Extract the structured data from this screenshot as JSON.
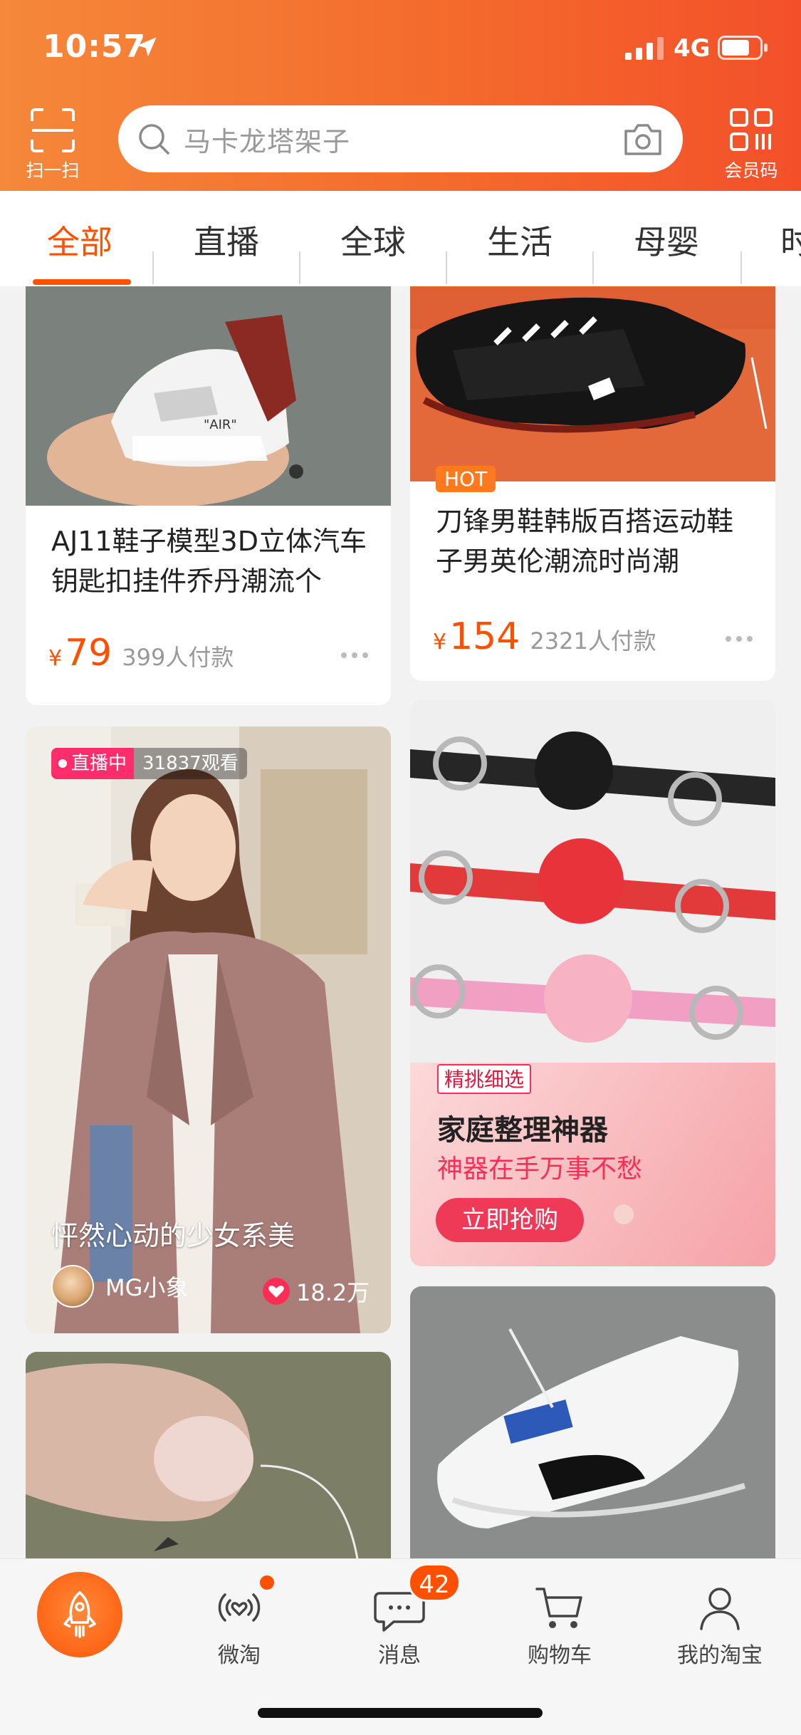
{
  "status_bar": {
    "time": "10:57",
    "network": "4G"
  },
  "header": {
    "scan_label": "扫一扫",
    "search_placeholder": "马卡龙塔架子",
    "member_label": "会员码"
  },
  "tabs": [
    "全部",
    "直播",
    "全球",
    "生活",
    "母婴",
    "时"
  ],
  "active_tab": "全部",
  "feed": {
    "left_top": {
      "title": "AJ11鞋子模型3D立体汽车钥匙扣挂件乔丹潮流个",
      "yen": "¥",
      "price": "79",
      "sold": "399人付款"
    },
    "right_top": {
      "badge": "HOT",
      "title": "刀锋男鞋韩版百搭运动鞋子男英伦潮流时尚潮",
      "yen": "¥",
      "price": "154",
      "sold": "2321人付款"
    },
    "live": {
      "tag": "直播中",
      "viewers": "31837观看",
      "title": "怦然心动的少女系美",
      "author": "MG小象",
      "likes": "18.2万"
    },
    "promo": {
      "badge": "精挑细选",
      "title": "家庭整理神器",
      "subtitle": "神器在手万事不愁",
      "button": "立即抢购"
    }
  },
  "tabbar": {
    "items": [
      "微淘",
      "消息",
      "购物车",
      "我的淘宝"
    ],
    "message_badge": "42"
  },
  "colors": {
    "brand": "#ff5000",
    "header_start": "#f5883a",
    "header_end": "#f3502a",
    "live": "#ff2d6b"
  }
}
